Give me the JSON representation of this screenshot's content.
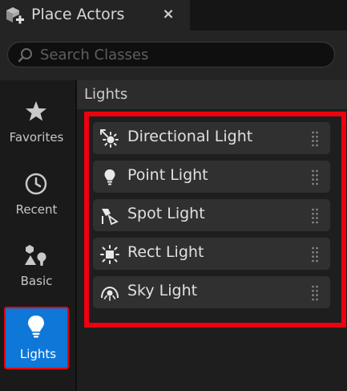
{
  "tab": {
    "title": "Place Actors",
    "close_glyph": "×",
    "icon": "place-actors-icon"
  },
  "search": {
    "placeholder": "Search Classes",
    "value": ""
  },
  "categories": [
    {
      "label": "Favorites",
      "icon": "star-icon",
      "active": false
    },
    {
      "label": "Recent",
      "icon": "clock-icon",
      "active": false
    },
    {
      "label": "Basic",
      "icon": "basic-shapes-icon",
      "active": false
    },
    {
      "label": "Lights",
      "icon": "lightbulb-icon",
      "active": true
    }
  ],
  "section": {
    "title": "Lights"
  },
  "items": [
    {
      "label": "Directional Light",
      "icon": "directional-light-icon"
    },
    {
      "label": "Point Light",
      "icon": "point-light-icon"
    },
    {
      "label": "Spot Light",
      "icon": "spot-light-icon"
    },
    {
      "label": "Rect Light",
      "icon": "rect-light-icon"
    },
    {
      "label": "Sky Light",
      "icon": "sky-light-icon"
    }
  ],
  "colors": {
    "accent": "#0e77d8",
    "highlight": "#ee0010"
  }
}
